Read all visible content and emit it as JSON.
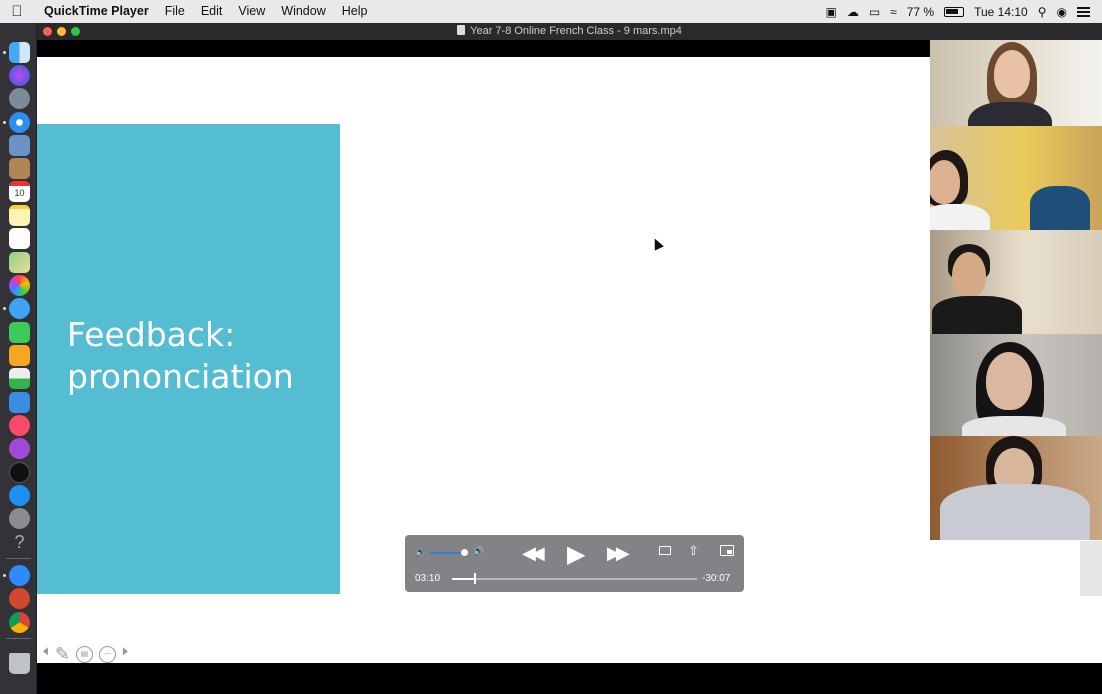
{
  "menubar": {
    "apple_icon": "apple-icon",
    "app_name": "QuickTime Player",
    "menus": [
      "File",
      "Edit",
      "View",
      "Window",
      "Help"
    ],
    "status": {
      "battery_percent": "77 %",
      "clock": "Tue 14:10"
    }
  },
  "window": {
    "title": "Year 7-8 Online French Class - 9 mars.mp4"
  },
  "slide": {
    "heading_line1": "Feedback:",
    "heading_line2": "prononciation"
  },
  "participants": [
    {
      "id": "participant-1"
    },
    {
      "id": "participant-2"
    },
    {
      "id": "participant-3"
    },
    {
      "id": "participant-4"
    },
    {
      "id": "participant-5"
    }
  ],
  "player": {
    "current_time": "03:10",
    "remaining_time": "-30:07",
    "progress_fraction": 0.094,
    "volume_fraction": 0.85
  },
  "dock": {
    "calendar_day": "10",
    "items": [
      "finder",
      "siri",
      "launchpad",
      "safari",
      "preview",
      "contacts",
      "calendar",
      "notes",
      "reminders",
      "maps",
      "photos",
      "messages",
      "facetime",
      "keynote-pages",
      "numbers",
      "keynote",
      "music",
      "podcasts",
      "apple-tv",
      "app-store",
      "system-preferences",
      "help",
      "zoom",
      "powerpoint",
      "chrome",
      "trash"
    ]
  },
  "colors": {
    "slide_accent": "#55bdd1",
    "volume_accent": "#2f7fe4"
  }
}
